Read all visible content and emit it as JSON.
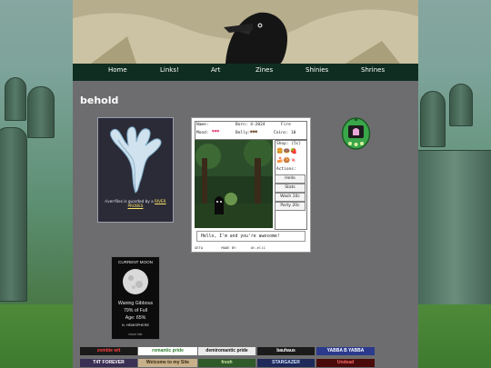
{
  "nav": {
    "items": [
      "Home",
      "Links!",
      "Art",
      "Zines",
      "Shinies",
      "Shrines"
    ]
  },
  "page": {
    "heading": "behold"
  },
  "river_widget": {
    "caption_prefix": "river-files is guarded by a",
    "caption_link": "RIVER PROBES"
  },
  "pet_widget": {
    "name_label": "Name:",
    "born_label": "Born: 4-2024",
    "fire_label": "Fire",
    "mood_label": "Mood:",
    "belly_label": "Belly:",
    "coins_label": "Coins: 10",
    "shop_label": "Shop: (5c)",
    "actions_label": "Actions:",
    "actions": [
      "Hello",
      "Stats",
      "Wash 10c",
      "Party 20c"
    ],
    "message": "Hello, I'm and you're awesome!",
    "footer_left": "GETA",
    "footer_mid": "MADE BY",
    "footer_right": "Ot-ell1"
  },
  "moon_widget": {
    "title": "CURRENT MOON",
    "phase": "Waning Gibbous",
    "percent_full": "79% of Full",
    "age": "Age: 65%",
    "hemisphere": "N. HEMISPHERE",
    "footer": "moon info"
  },
  "stamps": [
    {
      "text": "zombie wit",
      "bg": "#1a1a1a",
      "fg": "#ff4040"
    },
    {
      "text": "romantic pride",
      "bg": "#ffffff",
      "fg": "#2a7a2a"
    },
    {
      "text": "demiromantic pride",
      "bg": "#eaeaea",
      "fg": "#111111"
    },
    {
      "text": "bauhaus",
      "bg": "#1b1b1b",
      "fg": "#ffffff"
    },
    {
      "text": "YABBA B YABBA",
      "bg": "#2b3a8c",
      "fg": "#ffffff"
    },
    {
      "text": "T4T FOREVER",
      "bg": "#3a2f55",
      "fg": "#ffffff"
    },
    {
      "text": "Welcome to my Site",
      "bg": "#c7b08a",
      "fg": "#3a2a10"
    },
    {
      "text": "fresh",
      "bg": "#2f5a2a",
      "fg": "#cfe9a8"
    },
    {
      "text": "STARGAZER",
      "bg": "#1f2a5a",
      "fg": "#cfe0ff"
    },
    {
      "text": "Undead",
      "bg": "#4b0b0b",
      "fg": "#ff6a6a"
    }
  ]
}
